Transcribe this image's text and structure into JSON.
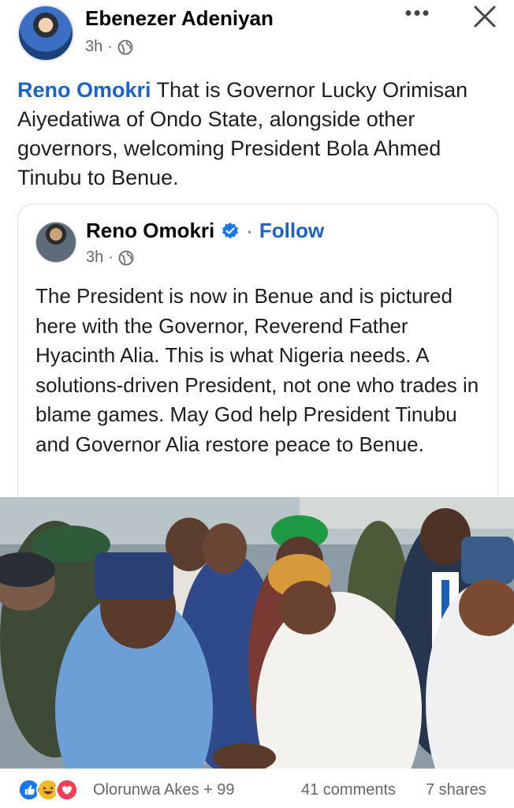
{
  "post": {
    "author": "Ebenezer Adeniyan",
    "time": "3h",
    "privacy_icon": "globe-icon",
    "more_icon": "more-horizontal-icon",
    "close_icon": "close-icon",
    "mention": "Reno Omokri",
    "text": " That is Governor Lucky Orimisan Aiyedatiwa of Ondo State, alongside other governors, welcoming President Bola Ahmed Tinubu to Benue."
  },
  "shared": {
    "author": "Reno Omokri",
    "verified_icon": "verified-badge-icon",
    "separator": "·",
    "follow_label": "Follow",
    "time": "3h",
    "text": "The President is now in Benue and is pictured here with the Governor, Reverend Father Hyacinth Alia. This is what Nigeria needs. A solutions-driven President, not one who trades in blame games. May God help President Tinubu and Governor Alia restore peace to Benue."
  },
  "footer": {
    "reaction_icons": [
      "like-icon",
      "haha-icon",
      "love-icon"
    ],
    "reaction_text": "Olorunwa Akes + 99",
    "comments": "41 comments",
    "shares": "7 shares"
  },
  "colors": {
    "link": "#1b63c8",
    "like": "#1877f2",
    "haha": "#f7b928",
    "love": "#f33e58"
  }
}
